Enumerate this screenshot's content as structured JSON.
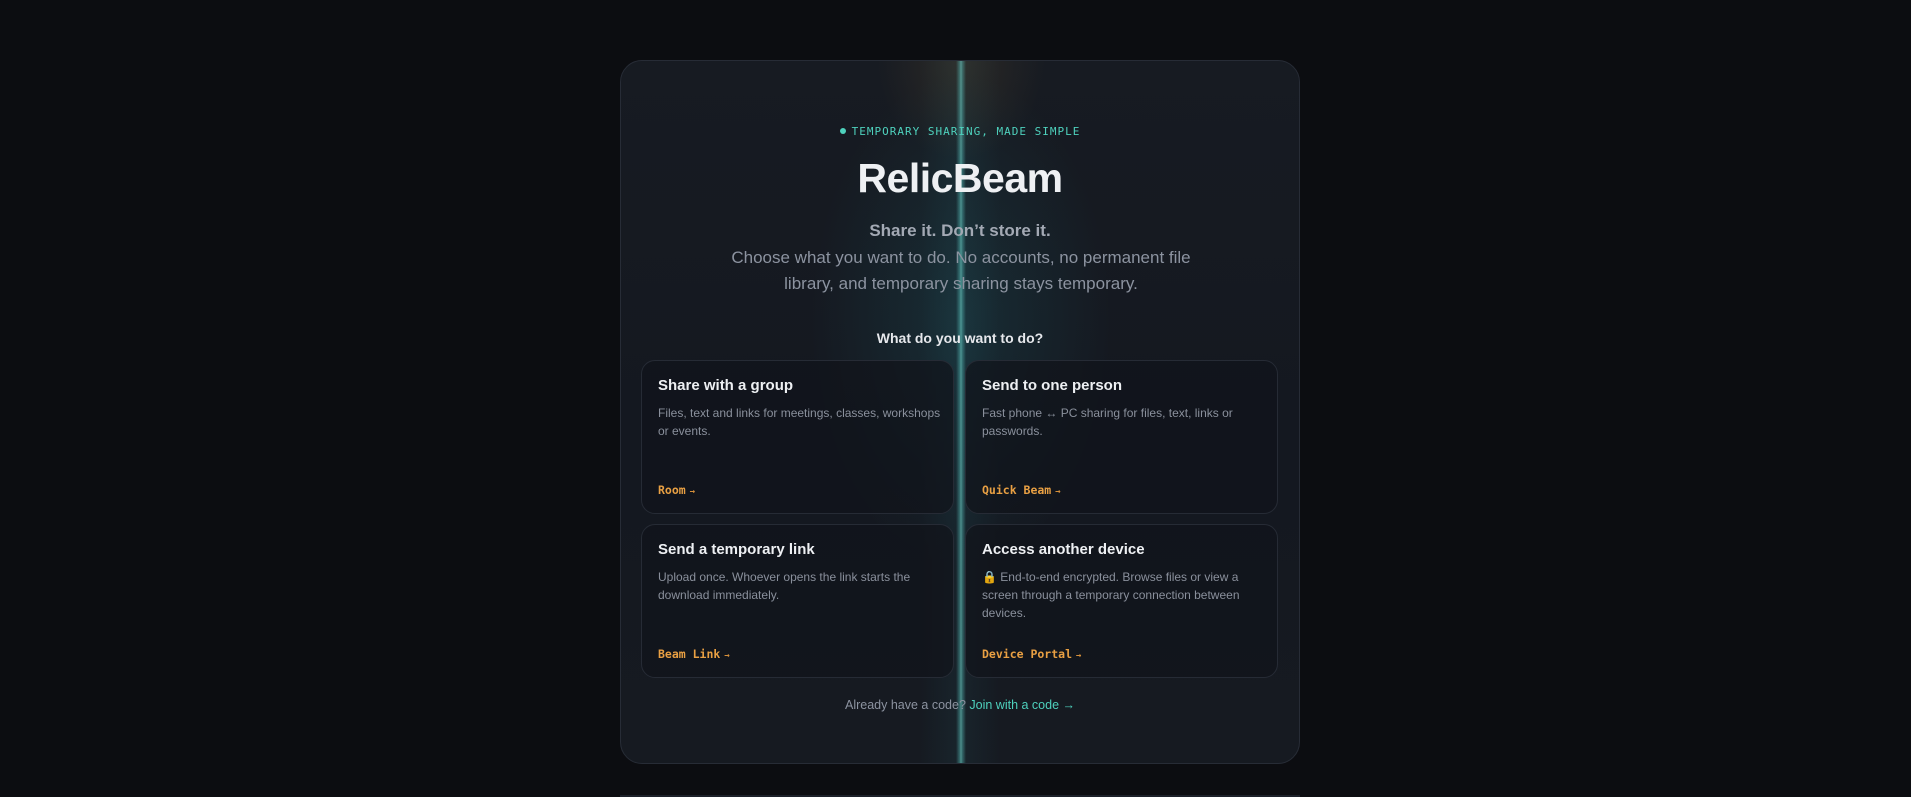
{
  "hero": {
    "eyebrow": "TEMPORARY SHARING, MADE SIMPLE",
    "title": "RelicBeam",
    "tagline": "Share it. Don’t store it.",
    "description": "Choose what you want to do. No accounts, no permanent file library, and temporary sharing stays temporary."
  },
  "question": "What do you want to do?",
  "options": [
    {
      "title": "Share with a group",
      "description": "Files, text and links for meetings, classes, workshops or events.",
      "link": "Room",
      "arrow": "→"
    },
    {
      "title": "Send to one person",
      "description": "Fast phone ↔ PC sharing for files, text, links or passwords.",
      "link": "Quick Beam",
      "arrow": "→"
    },
    {
      "title": "Send a temporary link",
      "description": "Upload once. Whoever opens the link starts the download immediately.",
      "link": "Beam Link",
      "arrow": "→"
    },
    {
      "title": "Access another device",
      "description": "🔒 End-to-end encrypted. Browse files or view a screen through a temporary connection between devices.",
      "link": "Device Portal",
      "arrow": "→"
    }
  ],
  "footer": {
    "prompt": "Already have a code?",
    "join_link": "Join with a code →"
  },
  "colors": {
    "background": "#0c0d11",
    "accent_teal": "#4ed1bd",
    "accent_orange": "#e9a043"
  }
}
